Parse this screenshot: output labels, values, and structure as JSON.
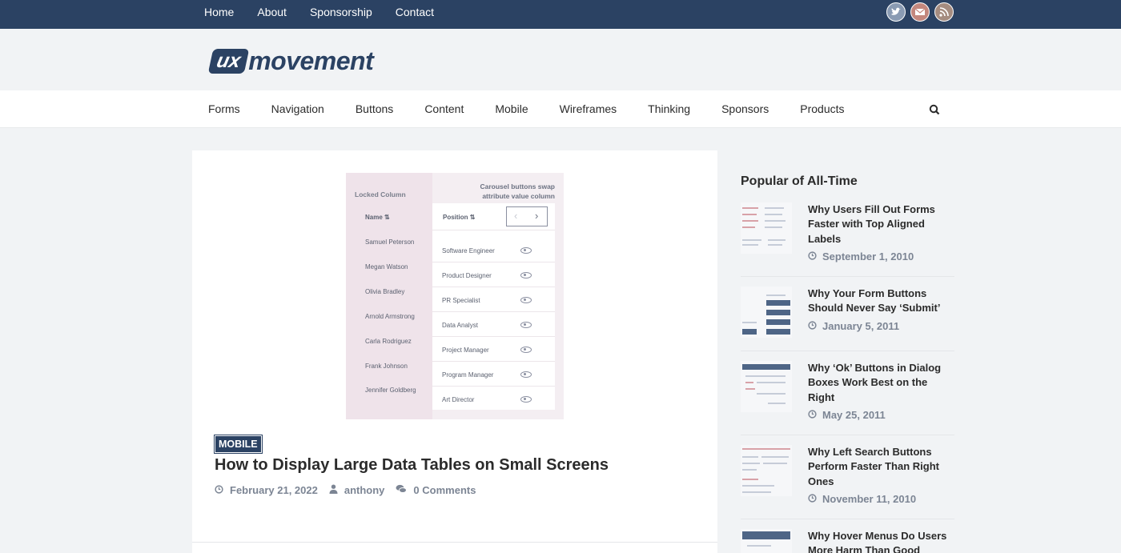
{
  "topbar": {
    "nav": [
      "Home",
      "About",
      "Sponsorship",
      "Contact"
    ],
    "social": [
      "twitter-icon",
      "mail-icon",
      "rss-icon"
    ],
    "background": "#2b4263"
  },
  "logo": {
    "ux": "ux",
    "movement": "movement"
  },
  "main_nav": {
    "items": [
      "Forms",
      "Navigation",
      "Buttons",
      "Content",
      "Mobile",
      "Wireframes",
      "Thinking",
      "Sponsors",
      "Products"
    ],
    "search_icon": "search-icon"
  },
  "post": {
    "image": {
      "locked_label": "Locked Column",
      "caption": "Carousel buttons swap attribute value column",
      "header_name": "Name ⇅",
      "header_position": "Position ⇅",
      "rows": [
        {
          "name": "Samuel Peterson",
          "position": "Software Engineer"
        },
        {
          "name": "Megan Watson",
          "position": "Product Designer"
        },
        {
          "name": "Olivia Bradley",
          "position": "PR Specialist"
        },
        {
          "name": "Arnold Armstrong",
          "position": "Data Analyst"
        },
        {
          "name": "Carla Rodriguez",
          "position": "Project Manager"
        },
        {
          "name": "Frank Johnson",
          "position": "Program Manager"
        },
        {
          "name": "Jennifer Goldberg",
          "position": "Art Director"
        }
      ]
    },
    "category": "MOBILE",
    "title": "How to Display Large Data Tables on Small Screens",
    "date": "February 21, 2022",
    "author": "anthony",
    "comments": "0 Comments"
  },
  "sidebar": {
    "title": "Popular of All-Time",
    "items": [
      {
        "title": "Why Users Fill Out Forms Faster with Top Aligned Labels",
        "date": "September 1, 2010"
      },
      {
        "title": "Why Your Form Buttons Should Never Say ‘Submit’",
        "date": "January 5, 2011"
      },
      {
        "title": "Why ‘Ok’ Buttons in Dialog Boxes Work Best on the Right",
        "date": "May 25, 2011"
      },
      {
        "title": "Why Left Search Buttons Perform Faster Than Right Ones",
        "date": "November 11, 2010"
      },
      {
        "title": "Why Hover Menus Do Users More Harm Than Good",
        "date": ""
      }
    ]
  },
  "colors": {
    "brand": "#2b4263",
    "meta": "#7c8594",
    "background": "#f1f3f5"
  }
}
